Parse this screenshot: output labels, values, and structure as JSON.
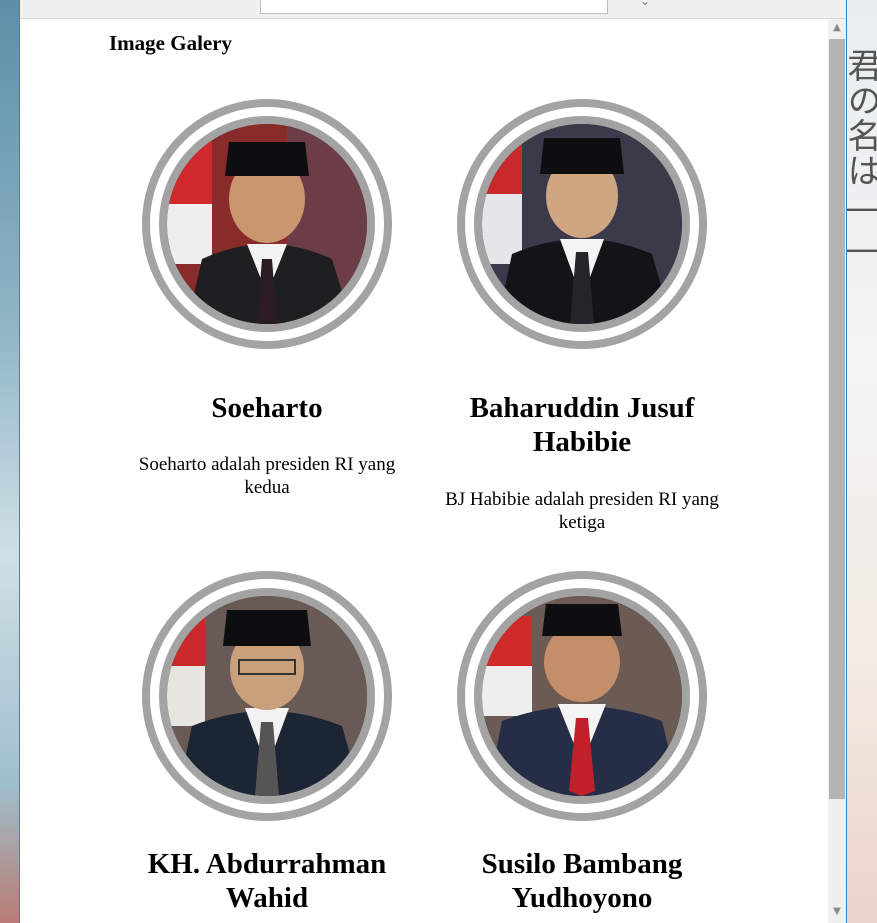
{
  "page": {
    "title": "Image Galery"
  },
  "desktop": {
    "side_text": "君の名は――"
  },
  "gallery": [
    {
      "name": "Soeharto",
      "description": "Soeharto adalah presiden RI yang kedua",
      "photo_bg": "#8a2b2b",
      "suit": "#1f1f22",
      "tie": "#2a1c22",
      "flag": true
    },
    {
      "name": "Baharuddin Jusuf Habibie",
      "description": "BJ Habibie adalah presiden RI yang ketiga",
      "photo_bg": "#3b3a4a",
      "suit": "#141418",
      "tie": "#26262a",
      "flag": true
    },
    {
      "name": "KH. Abdurrahman Wahid",
      "description": "",
      "photo_bg": "#6a5a55",
      "suit": "#1c2533",
      "tie": "#555555",
      "flag": true
    },
    {
      "name": "Susilo Bambang Yudhoyono",
      "description": "",
      "photo_bg": "#6c5a54",
      "suit": "#262d46",
      "tie": "#c0202a",
      "flag": true
    }
  ],
  "icons": {
    "scroll_up": "▲",
    "scroll_down": "▼"
  },
  "colors": {
    "ring": "#a3a3a3",
    "window_border": "#2f86c8"
  }
}
